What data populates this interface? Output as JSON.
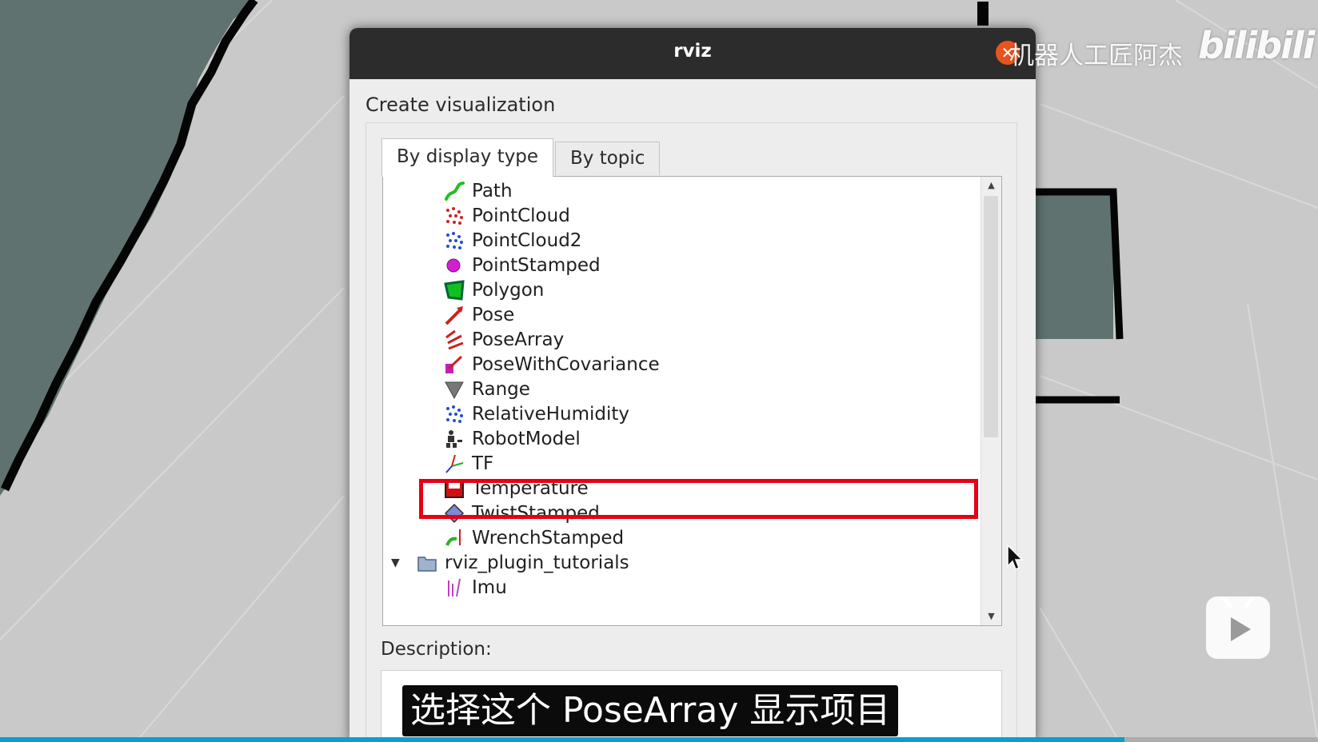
{
  "window": {
    "title": "rviz"
  },
  "dialog": {
    "heading": "Create visualization",
    "tabs": [
      {
        "label": "By display type",
        "active": true
      },
      {
        "label": "By topic",
        "active": false
      }
    ],
    "list_items": [
      {
        "label": "Path",
        "icon": "path-icon"
      },
      {
        "label": "PointCloud",
        "icon": "pointcloud-icon"
      },
      {
        "label": "PointCloud2",
        "icon": "pointcloud2-icon"
      },
      {
        "label": "PointStamped",
        "icon": "pointstamped-icon"
      },
      {
        "label": "Polygon",
        "icon": "polygon-icon"
      },
      {
        "label": "Pose",
        "icon": "pose-icon"
      },
      {
        "label": "PoseArray",
        "icon": "posearray-icon",
        "selected": true
      },
      {
        "label": "PoseWithCovariance",
        "icon": "posewithcovariance-icon"
      },
      {
        "label": "Range",
        "icon": "range-icon"
      },
      {
        "label": "RelativeHumidity",
        "icon": "relativehumidity-icon"
      },
      {
        "label": "RobotModel",
        "icon": "robotmodel-icon"
      },
      {
        "label": "TF",
        "icon": "tf-icon"
      },
      {
        "label": "Temperature",
        "icon": "temperature-icon"
      },
      {
        "label": "TwistStamped",
        "icon": "twiststamped-icon"
      },
      {
        "label": "WrenchStamped",
        "icon": "wrenchstamped-icon"
      },
      {
        "label": "rviz_plugin_tutorials",
        "icon": "folder-icon",
        "expanded": true
      },
      {
        "label": "Imu",
        "icon": "imu-icon"
      }
    ],
    "description_label": "Description:"
  },
  "overlay": {
    "subtitle": "选择这个 PoseArray 显示项目",
    "watermark": "机器人工匠阿杰",
    "brand": "bilibili",
    "progress": 0.853
  },
  "colors": {
    "accent": "#e60012",
    "close": "#e9541e",
    "progress": "#00a1d6",
    "floor": "#c9c9c9",
    "map": "#5f7270"
  }
}
